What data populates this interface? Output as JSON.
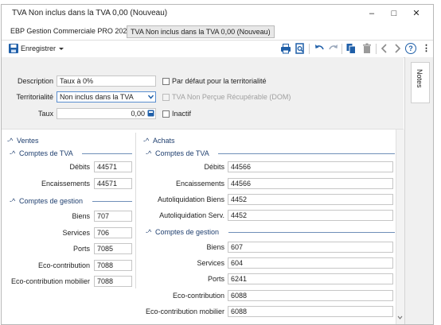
{
  "window": {
    "title": "TVA Non inclus dans la TVA 0,00 (Nouveau)",
    "minimize": "–",
    "maximize": "□",
    "close": "✕"
  },
  "tabs": [
    {
      "label": "EBP Gestion Commerciale PRO 2021"
    },
    {
      "label": "TVA Non inclus dans la TVA 0,00 (Nouveau)"
    }
  ],
  "toolbar": {
    "save_label": "Enregistrer",
    "more": "⋮",
    "help": "?"
  },
  "side_panel": {
    "notes_label": "Notes"
  },
  "form": {
    "description_label": "Description",
    "description_value": "Taux à 0%",
    "territoriality_label": "Territorialité",
    "territoriality_value": "Non inclus dans la TVA",
    "rate_label": "Taux",
    "rate_value": "0,00",
    "default_territoriality_label": "Par défaut pour la territorialité",
    "tva_non_percue_label": "TVA Non Perçue Récupérable (DOM)",
    "inactive_label": "Inactif"
  },
  "ventes": {
    "title": "Ventes",
    "comptes_tva_title": "Comptes de TVA",
    "debits_label": "Débits",
    "debits_value": "44571",
    "encaissements_label": "Encaissements",
    "encaissements_value": "44571",
    "comptes_gestion_title": "Comptes de gestion",
    "biens_label": "Biens",
    "biens_value": "707",
    "services_label": "Services",
    "services_value": "706",
    "ports_label": "Ports",
    "ports_value": "7085",
    "eco_label": "Eco-contribution",
    "eco_value": "7088",
    "eco_mobilier_label": "Eco-contribution mobilier",
    "eco_mobilier_value": "7088"
  },
  "achats": {
    "title": "Achats",
    "comptes_tva_title": "Comptes de TVA",
    "debits_label": "Débits",
    "debits_value": "44566",
    "encaissements_label": "Encaissements",
    "encaissements_value": "44566",
    "autoliq_biens_label": "Autoliquidation Biens",
    "autoliq_biens_value": "4452",
    "autoliq_serv_label": "Autoliquidation Serv.",
    "autoliq_serv_value": "4452",
    "comptes_gestion_title": "Comptes de gestion",
    "biens_label": "Biens",
    "biens_value": "607",
    "services_label": "Services",
    "services_value": "604",
    "ports_label": "Ports",
    "ports_value": "6241",
    "eco_label": "Eco-contribution",
    "eco_value": "6088",
    "eco_mobilier_label": "Eco-contribution mobilier",
    "eco_mobilier_value": "6088"
  },
  "colors": {
    "accent": "#1f5fa8",
    "section_line": "#6f8fb8"
  }
}
